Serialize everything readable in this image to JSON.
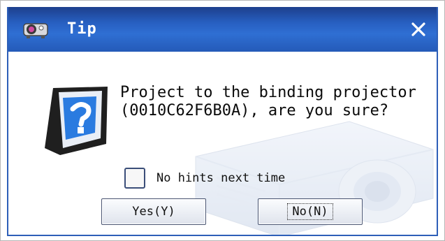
{
  "dialog": {
    "title": "Tip",
    "close_glyph": "✕",
    "title_icon": "projector-app-icon",
    "message_line1": "Project to the binding projector",
    "message_line2": "(0010C62F6B0A), are you sure?",
    "help_icon": "help-question-icon",
    "hint_label": "No hints next time",
    "yes_label": "Yes(Y)",
    "no_label": "No(N)",
    "colors": {
      "title_bar": "#2f6fd3",
      "border": "#2d5fb8"
    }
  }
}
